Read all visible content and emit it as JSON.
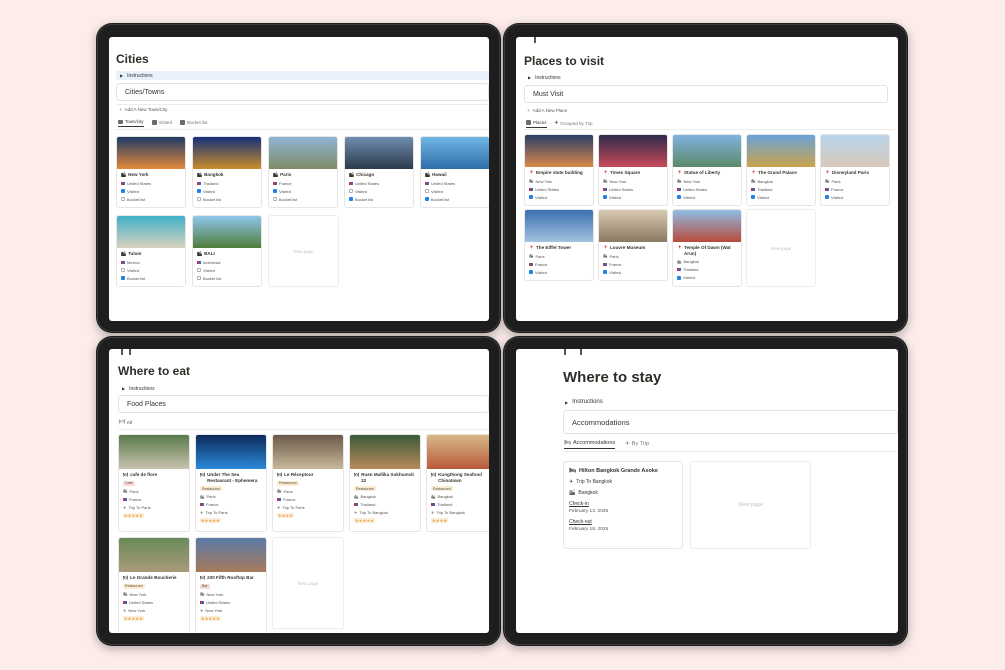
{
  "cities": {
    "title": "Cities",
    "instructions": "Instructions",
    "database_title": "Cities/Towns",
    "add_button": "Add A New Town/City",
    "tabs": [
      "Town/city",
      "Visited",
      "Bucket list"
    ],
    "cards": [
      {
        "name": "New York",
        "country": "United States",
        "visited": true,
        "bucket": false,
        "img_a": "#1f3a66",
        "img_b": "#e48a3a"
      },
      {
        "name": "Bangkok",
        "country": "Thailand",
        "visited": true,
        "bucket": false,
        "img_a": "#16307a",
        "img_b": "#c98d2a"
      },
      {
        "name": "Paris",
        "country": "France",
        "visited": true,
        "bucket": false,
        "img_a": "#8fb5d8",
        "img_b": "#7d8c63"
      },
      {
        "name": "Chicago",
        "country": "United States",
        "visited": false,
        "bucket": true,
        "img_a": "#6f8db0",
        "img_b": "#2d3a4a"
      },
      {
        "name": "Hawaii",
        "country": "United States",
        "visited": false,
        "bucket": true,
        "img_a": "#6fb6e6",
        "img_b": "#2d6da8"
      },
      {
        "name": "Tulum",
        "country": "Mexico",
        "visited": false,
        "bucket": true,
        "img_a": "#3fb0c8",
        "img_b": "#d9d2bf"
      },
      {
        "name": "BALI",
        "country": "Indonesia",
        "visited": false,
        "bucket": false,
        "img_a": "#8fc6ec",
        "img_b": "#4e7c3a"
      }
    ],
    "new_page": "New page",
    "visited_label": "Visited",
    "bucket_label": "Bucket list"
  },
  "places": {
    "title": "Places to visit",
    "instructions": "Instructions",
    "database_title": "Must Visit",
    "add_button": "Add A New Place",
    "tabs": [
      "Places",
      "Grouped by Trip"
    ],
    "cards": [
      {
        "name": "Empire state building",
        "city": "New York",
        "country": "United States",
        "visited": true,
        "img_a": "#2a3f6a",
        "img_b": "#d98a4a"
      },
      {
        "name": "Times Square",
        "city": "New York",
        "country": "United States",
        "visited": true,
        "img_a": "#2c2a4a",
        "img_b": "#c94a5a"
      },
      {
        "name": "Statue of Liberty",
        "city": "New York",
        "country": "United States",
        "visited": true,
        "img_a": "#7fb3e0",
        "img_b": "#5c8a6a"
      },
      {
        "name": "The Grand Palace",
        "city": "Bangkok",
        "country": "Thailand",
        "visited": true,
        "img_a": "#6aa3d8",
        "img_b": "#c9a44a"
      },
      {
        "name": "Disneyland Paris",
        "city": "Paris",
        "country": "France",
        "visited": true,
        "img_a": "#b8d4ec",
        "img_b": "#d9c9b8"
      },
      {
        "name": "The Eiffel Tower",
        "city": "Paris",
        "country": "France",
        "visited": true,
        "img_a": "#3a6fb0",
        "img_b": "#a3c4e0"
      },
      {
        "name": "Louvre Museum",
        "city": "Paris",
        "country": "France",
        "visited": true,
        "img_a": "#d8c9b0",
        "img_b": "#8a7a62"
      },
      {
        "name": "Temple Of Dawn (Wat Arun)",
        "city": "Bangkok",
        "country": "Thailand",
        "visited": true,
        "img_a": "#8fbde6",
        "img_b": "#b84a3a"
      }
    ],
    "new_page": "New page",
    "visited_label": "Visited"
  },
  "eat": {
    "title": "Where to eat",
    "instructions": "Instructions",
    "database_title": "Food Places",
    "tabs": [
      "All"
    ],
    "cards": [
      {
        "name": "cafe de flore",
        "tag": "Cafe",
        "tag_color": "#fbdada",
        "city": "Paris",
        "country": "France",
        "trip": "Trip To Paris",
        "stars": "★★★★★",
        "img_a": "#5a7a4a",
        "img_b": "#c9c2b0"
      },
      {
        "name": "Under The Sea Restaurant - Ephemera",
        "tag": "Restaurant",
        "tag_color": "#fbecd0",
        "city": "Paris",
        "country": "France",
        "trip": "Trip To Paris",
        "stars": "★★★★★",
        "img_a": "#0e2a5a",
        "img_b": "#2a8ad8"
      },
      {
        "name": "Le Réceptour",
        "tag": "Restaurant",
        "tag_color": "#fbecd0",
        "city": "Paris",
        "country": "France",
        "trip": "Trip To Paris",
        "stars": "★★★★",
        "img_a": "#6a5a4a",
        "img_b": "#c8b89a"
      },
      {
        "name": "Ruen Mallika Sukhumvit 22",
        "tag": "Restaurant",
        "tag_color": "#fbecd0",
        "city": "Bangkok",
        "country": "Thailand",
        "trip": "Trip To Bangkok",
        "stars": "★★★★★",
        "img_a": "#3a5a3a",
        "img_b": "#b88a5a"
      },
      {
        "name": "Kungthong Seafood Chinatown",
        "tag": "Restaurant",
        "tag_color": "#fbecd0",
        "city": "Bangkok",
        "country": "Thailand",
        "trip": "Trip To Bangkok",
        "stars": "★★★★",
        "img_a": "#d8b88a",
        "img_b": "#b85a3a"
      },
      {
        "name": "Le Grande Boucherie",
        "tag": "Restaurant",
        "tag_color": "#fbecd0",
        "city": "New York",
        "country": "United States",
        "trip": "New York",
        "stars": "★★★★★",
        "img_a": "#6a8a5a",
        "img_b": "#a89a7a"
      },
      {
        "name": "230 Fifth Rooftop Bar",
        "tag": "Bar",
        "tag_color": "#f3dcd0",
        "city": "New York",
        "country": "United States",
        "trip": "New York",
        "stars": "★★★★★",
        "img_a": "#5a7aa8",
        "img_b": "#a87a5a"
      }
    ],
    "new_page": "New page"
  },
  "stay": {
    "title": "Where to stay",
    "instructions": "Instructions",
    "database_title": "Accommodations",
    "tabs": [
      "Accommodations",
      "By Trip"
    ],
    "card": {
      "name": "Hilton Bangkok Grande Asoke",
      "trip": "Trip To Bangkok",
      "city": "Bangkok",
      "checkin_label": "Check-in",
      "checkin": "February 13, 2025",
      "checkout_label": "Check-out",
      "checkout": "February 18, 2025"
    },
    "new_page": "New page"
  }
}
